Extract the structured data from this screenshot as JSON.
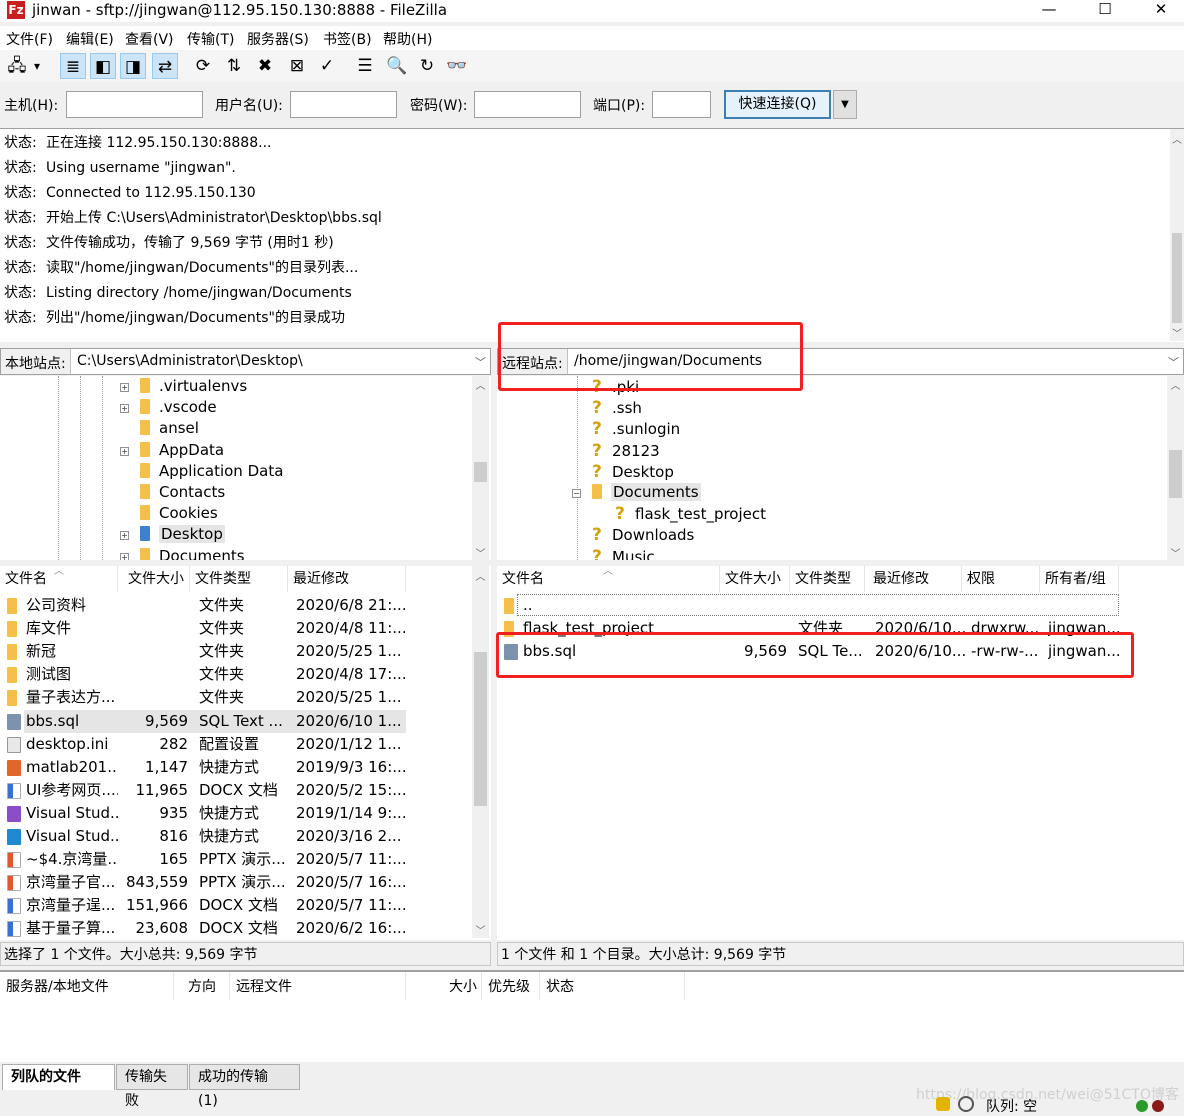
{
  "window": {
    "title": "jinwan - sftp://jingwan@112.95.150.130:8888 - FileZilla",
    "app_icon": "Fz",
    "minimize": "—",
    "maximize": "☐",
    "close": "✕"
  },
  "menu": [
    "文件(F)",
    "编辑(E)",
    "查看(V)",
    "传输(T)",
    "服务器(S)",
    "书签(B)",
    "帮助(H)"
  ],
  "toolbar": [
    {
      "icon": "site-manager-icon",
      "glyph": "🖧"
    },
    {
      "icon": "dropdown-icon",
      "glyph": "▾"
    },
    {
      "icon": "message-log-toggle-icon",
      "glyph": "≣",
      "active": true
    },
    {
      "icon": "local-tree-toggle-icon",
      "glyph": "◧",
      "active": true
    },
    {
      "icon": "remote-tree-toggle-icon",
      "glyph": "◨",
      "active": true
    },
    {
      "icon": "transfer-queue-toggle-icon",
      "glyph": "⇄",
      "active": true
    },
    {
      "icon": "refresh-icon",
      "glyph": "⟳"
    },
    {
      "icon": "process-queue-icon",
      "glyph": "⇅"
    },
    {
      "icon": "cancel-icon",
      "glyph": "✖"
    },
    {
      "icon": "disconnect-icon",
      "glyph": "⊠"
    },
    {
      "icon": "reconnect-icon",
      "glyph": "✓"
    },
    {
      "icon": "directory-filter-icon",
      "glyph": "☰"
    },
    {
      "icon": "toggle-comparison-icon",
      "glyph": "🔍"
    },
    {
      "icon": "sync-browsing-icon",
      "glyph": "↻"
    },
    {
      "icon": "search-remote-icon",
      "glyph": "👓"
    }
  ],
  "quickconnect": {
    "host_label": "主机(H):",
    "host": "",
    "user_label": "用户名(U):",
    "user": "",
    "pass_label": "密码(W):",
    "pass": "",
    "port_label": "端口(P):",
    "port": "",
    "button": "快速连接(Q)"
  },
  "log": [
    {
      "k": "状态:",
      "v": "正在连接 112.95.150.130:8888..."
    },
    {
      "k": "状态:",
      "v": "Using username \"jingwan\"."
    },
    {
      "k": "状态:",
      "v": "Connected to 112.95.150.130"
    },
    {
      "k": "状态:",
      "v": "开始上传 C:\\Users\\Administrator\\Desktop\\bbs.sql"
    },
    {
      "k": "状态:",
      "v": "文件传输成功，传输了 9,569 字节 (用时1 秒)"
    },
    {
      "k": "状态:",
      "v": "读取\"/home/jingwan/Documents\"的目录列表..."
    },
    {
      "k": "状态:",
      "v": "Listing directory /home/jingwan/Documents"
    },
    {
      "k": "状态:",
      "v": "列出\"/home/jingwan/Documents\"的目录成功"
    }
  ],
  "local": {
    "label": "本地站点:",
    "path": "C:\\Users\\Administrator\\Desktop\\",
    "tree": [
      {
        "name": ".virtualenvs",
        "exp": "+"
      },
      {
        "name": ".vscode",
        "exp": "+"
      },
      {
        "name": "ansel"
      },
      {
        "name": "AppData",
        "exp": "+"
      },
      {
        "name": "Application Data"
      },
      {
        "name": "Contacts"
      },
      {
        "name": "Cookies"
      },
      {
        "name": "Desktop",
        "exp": "+",
        "selected": true
      },
      {
        "name": "Documents",
        "exp": "+"
      }
    ],
    "columns": [
      "文件名",
      "文件大小",
      "文件类型",
      "最近修改"
    ],
    "files": [
      {
        "name": "公司资料",
        "size": "",
        "type": "文件夹",
        "mod": "2020/6/8 21:...",
        "icon": "folder"
      },
      {
        "name": "库文件",
        "size": "",
        "type": "文件夹",
        "mod": "2020/4/8 11:...",
        "icon": "folder"
      },
      {
        "name": "新冠",
        "size": "",
        "type": "文件夹",
        "mod": "2020/5/25 1...",
        "icon": "folder"
      },
      {
        "name": "测试图",
        "size": "",
        "type": "文件夹",
        "mod": "2020/4/8 17:...",
        "icon": "folder"
      },
      {
        "name": "量子表达方...",
        "size": "",
        "type": "文件夹",
        "mod": "2020/5/25 1...",
        "icon": "folder"
      },
      {
        "name": "bbs.sql",
        "size": "9,569",
        "type": "SQL Text ...",
        "mod": "2020/6/10 1...",
        "icon": "sql",
        "selected": true
      },
      {
        "name": "desktop.ini",
        "size": "282",
        "type": "配置设置",
        "mod": "2020/1/12 1...",
        "icon": "ini"
      },
      {
        "name": "matlab201...",
        "size": "1,147",
        "type": "快捷方式",
        "mod": "2019/9/3 16:...",
        "icon": "matlab"
      },
      {
        "name": "UI参考网页....",
        "size": "11,965",
        "type": "DOCX 文档",
        "mod": "2020/5/2 15:...",
        "icon": "docx"
      },
      {
        "name": "Visual Stud...",
        "size": "935",
        "type": "快捷方式",
        "mod": "2019/1/14 9:...",
        "icon": "vs"
      },
      {
        "name": "Visual Stud...",
        "size": "816",
        "type": "快捷方式",
        "mod": "2020/3/16 2...",
        "icon": "vscode"
      },
      {
        "name": "~$4.京湾量...",
        "size": "165",
        "type": "PPTX 演示...",
        "mod": "2020/5/7 11:...",
        "icon": "pptx"
      },
      {
        "name": "京湾量子官...",
        "size": "843,559",
        "type": "PPTX 演示...",
        "mod": "2020/5/7 16:...",
        "icon": "pptx"
      },
      {
        "name": "京湾量子逞...",
        "size": "151,966",
        "type": "DOCX 文档",
        "mod": "2020/5/7 11:...",
        "icon": "docx"
      },
      {
        "name": "基于量子算...",
        "size": "23,608",
        "type": "DOCX 文档",
        "mod": "2020/6/2 16:...",
        "icon": "docx"
      }
    ],
    "status": "选择了 1 个文件。大小总共: 9,569 字节"
  },
  "remote": {
    "label": "远程站点:",
    "path": "/home/jingwan/Documents",
    "tree": [
      {
        "name": ".pki"
      },
      {
        "name": ".ssh"
      },
      {
        "name": ".sunlogin"
      },
      {
        "name": "28123"
      },
      {
        "name": "Desktop"
      },
      {
        "name": "Documents",
        "exp": "−",
        "folder": true,
        "selected": true
      },
      {
        "name": "flask_test_project",
        "child": true
      },
      {
        "name": "Downloads"
      },
      {
        "name": "Music"
      }
    ],
    "columns": [
      "文件名",
      "文件大小",
      "文件类型",
      "最近修改",
      "权限",
      "所有者/组"
    ],
    "files": [
      {
        "name": "..",
        "size": "",
        "type": "",
        "mod": "",
        "perm": "",
        "owner": ""
      },
      {
        "name": "flask_test_project",
        "size": "",
        "type": "文件夹",
        "mod": "2020/6/10...",
        "perm": "drwxrw...",
        "owner": "jingwan..."
      },
      {
        "name": "bbs.sql",
        "size": "9,569",
        "type": "SQL Te...",
        "mod": "2020/6/10...",
        "perm": "-rw-rw-...",
        "owner": "jingwan..."
      }
    ],
    "status": "1 个文件 和 1 个目录。大小总计: 9,569 字节"
  },
  "queue": {
    "columns": [
      "服务器/本地文件",
      "方向",
      "远程文件",
      "大小",
      "优先级",
      "状态"
    ],
    "tabs": [
      "列队的文件",
      "传输失败",
      "成功的传输 (1)"
    ],
    "status": "队列: 空"
  },
  "watermark": "https://blog.csdn.net/wei@51CTO博客",
  "colors": {
    "highlight": "#f0201f",
    "accent": "#3c7fb1"
  }
}
